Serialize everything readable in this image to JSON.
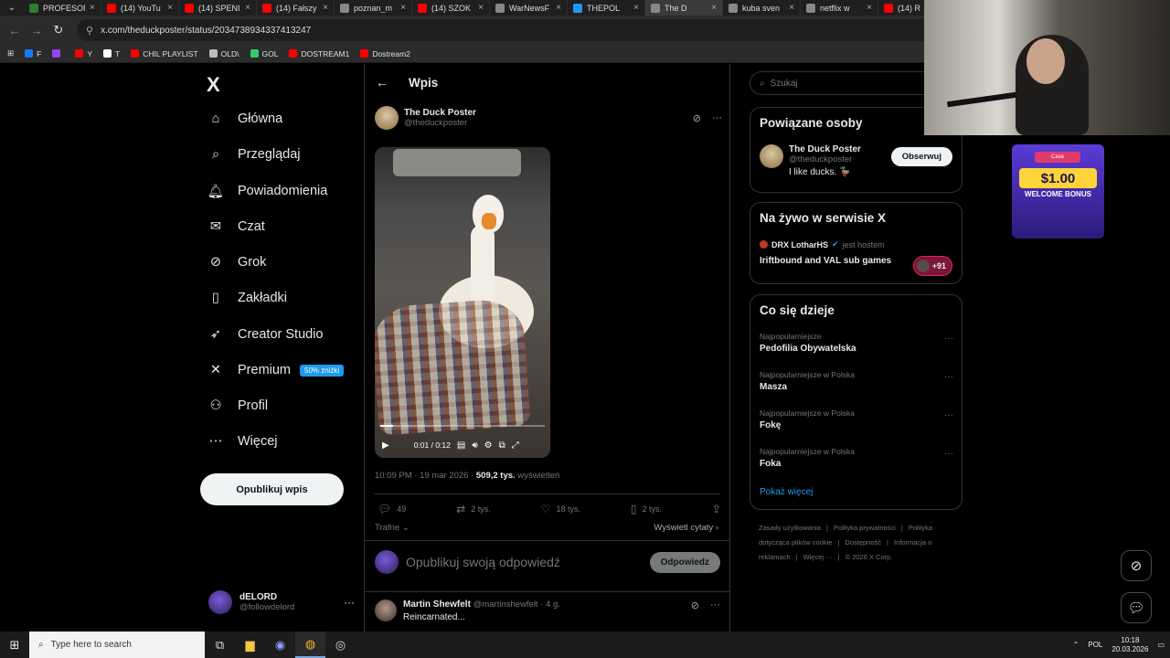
{
  "browser": {
    "tabs": [
      {
        "label": "PROFESOR",
        "color": "#2e7d32",
        "active": false
      },
      {
        "label": "(14) YouTu",
        "color": "#ff0000",
        "active": false
      },
      {
        "label": "(14) SPENI",
        "color": "#ff0000",
        "active": false
      },
      {
        "label": "(14) Fałszy",
        "color": "#ff0000",
        "active": false
      },
      {
        "label": "poznan_m",
        "color": "#888888",
        "active": false
      },
      {
        "label": "(14) SZOK",
        "color": "#ff0000",
        "active": false
      },
      {
        "label": "WarNewsF",
        "color": "#888888",
        "active": false
      },
      {
        "label": "THEPOL",
        "color": "#1d9bf0",
        "active": false
      },
      {
        "label": "The D",
        "color": "#888888",
        "active": true
      },
      {
        "label": "kuba sven",
        "color": "#888888",
        "active": false
      },
      {
        "label": "netflix w",
        "color": "#888888",
        "active": false
      },
      {
        "label": "(14) R",
        "color": "#ff0000",
        "active": false
      }
    ],
    "url": "x.com/theduckposter/status/2034738934337413247",
    "bookmarks": [
      {
        "label": "F",
        "color": "#1877f2"
      },
      {
        "label": "",
        "color": "#9146ff"
      },
      {
        "label": "Y",
        "color": "#ff0000"
      },
      {
        "label": "T",
        "color": "#ffffff"
      },
      {
        "label": "CHIL PLAYLIST",
        "color": "#ff0000"
      },
      {
        "label": "OLD\\",
        "color": "#bbbbbb"
      },
      {
        "label": "GOL",
        "color": "#2ecc71"
      },
      {
        "label": "DOSTREAM1",
        "color": "#ff0000"
      },
      {
        "label": "Dostream2",
        "color": "#ff0000"
      }
    ]
  },
  "nav": {
    "logo": "X",
    "items": [
      {
        "label": "Główna",
        "icon": "home-icon",
        "glyph": "⌂"
      },
      {
        "label": "Przeglądaj",
        "icon": "search-icon",
        "glyph": "⌕"
      },
      {
        "label": "Powiadomienia",
        "icon": "bell-icon",
        "glyph": "🔔︎"
      },
      {
        "label": "Czat",
        "icon": "mail-icon",
        "glyph": "✉"
      },
      {
        "label": "Grok",
        "icon": "grok-icon",
        "glyph": "⊘"
      },
      {
        "label": "Zakładki",
        "icon": "bookmark-icon",
        "glyph": "▯"
      },
      {
        "label": "Creator Studio",
        "icon": "rocket-icon",
        "glyph": "➶"
      },
      {
        "label": "Premium",
        "icon": "x-premium-icon",
        "glyph": "✕"
      },
      {
        "label": "Profil",
        "icon": "user-icon",
        "glyph": "⚇"
      },
      {
        "label": "Więcej",
        "icon": "more-circle-icon",
        "glyph": "⋯"
      }
    ],
    "premium_badge": "50% zniżki",
    "post_button": "Opublikuj wpis",
    "account": {
      "name": "dELORD",
      "handle": "@followdelord"
    }
  },
  "post": {
    "header_title": "Wpis",
    "author_name": "The Duck Poster",
    "author_handle": "@theduckposter",
    "video_time": "0:01 / 0:12",
    "video_progress": 0.08,
    "time": "10:09 PM · 19 mar 2026 · ",
    "views": "509,2 tys.",
    "views_label": " wyświetleń",
    "stats": {
      "replies": "49",
      "reposts": "2 tys.",
      "likes": "18 tys.",
      "bookmarks": "2 tys."
    },
    "sort_label": "Trafne ⌄",
    "quotes_label": "Wyświetl cytaty ›",
    "reply_placeholder": "Opublikuj swoją odpowiedź",
    "reply_button": "Odpowiedz",
    "comment": {
      "name": "Martin Shewfelt",
      "handle": "@martinshewfelt · 4 g.",
      "text": "Reincarnated..."
    }
  },
  "sidebar": {
    "search_placeholder": "Szukaj",
    "related": {
      "title": "Powiązane osoby",
      "name": "The Duck Poster",
      "handle": "@theduckposter",
      "bio": "I like ducks. 🦆",
      "follow": "Obserwuj"
    },
    "live": {
      "title": "Na żywo w serwisie X",
      "host": "DRX LotharHS",
      "role": "jest hostem",
      "stream_title": "Iriftbound and VAL sub games",
      "listeners": "+91"
    },
    "trends": {
      "title": "Co się dzieje",
      "items": [
        {
          "context": "Najpopularniejsze",
          "topic": "Pedofilia Obywatelska"
        },
        {
          "context": "Najpopularniejsze w Polska",
          "topic": "Masza"
        },
        {
          "context": "Najpopularniejsze w Polska",
          "topic": "Fokę"
        },
        {
          "context": "Najpopularniejsze w Polska",
          "topic": "Foka"
        }
      ],
      "show_more": "Pokaż więcej"
    },
    "footer": [
      "Zasady użytkowania",
      "|",
      "Polityka prywatności",
      "|",
      "Polityka dotycząca plików cookie",
      "|",
      "Dostępność",
      "|",
      "Informacja o reklamach",
      "|",
      "Więcej ···",
      "|",
      "© 2026 X Corp."
    ]
  },
  "ad": {
    "brand": "Case",
    "price": "$1.00",
    "label": "WELCOME BONUS"
  },
  "taskbar": {
    "search_placeholder": "Type here to search",
    "lang": "POL",
    "time": "10:18",
    "date": "20.03.2026"
  }
}
